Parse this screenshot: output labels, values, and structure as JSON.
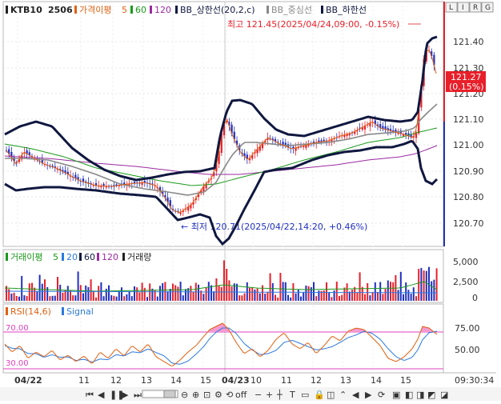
{
  "price_panel": {
    "legend": {
      "symbol": "KTB10",
      "code": "2506",
      "ma_label": "가격이평",
      "ma_5": "5",
      "ma_60": "60",
      "ma_120": "120",
      "bb_upper": "BB_상한선(20,2,c)",
      "bb_mid": "BB_중심선",
      "bb_lower": "BB_하한선"
    },
    "high_annotation": "최고 121.45(2025/04/24,09:00, -0.15%)",
    "low_annotation": "← 최저 120.71(2025/04/22,14:20, +0.46%)",
    "current_price": "121.27",
    "current_change": "(0.15%)",
    "y_ticks": [
      "121.40",
      "121.30",
      "121.20",
      "121.10",
      "121.00",
      "120.90",
      "120.80",
      "120.70"
    ]
  },
  "toolbar_icons": [
    "L",
    "I",
    "R",
    "G"
  ],
  "volume_panel": {
    "legend": {
      "ma_label": "거래이평",
      "ma_5": "5",
      "ma_20": "20",
      "ma_60": "60",
      "ma_120": "120",
      "volume": "거래량"
    },
    "y_ticks": [
      "5,000",
      "2,500",
      "0"
    ]
  },
  "rsi_panel": {
    "legend": {
      "rsi": "RSI(14,6)",
      "signal": "Signal"
    },
    "level_high": "70.00",
    "level_low": "30.00",
    "y_ticks": [
      "75.00",
      "50.00"
    ]
  },
  "x_axis": {
    "labels": [
      "04/22",
      "11",
      "12",
      "13",
      "14",
      "15",
      "04/23",
      "10",
      "11",
      "12",
      "13",
      "14",
      "15"
    ],
    "time": "09:30:34"
  },
  "colors": {
    "candle_up": "#e8202a",
    "candle_down": "#2030c0",
    "ma5": "#e06010",
    "ma20": "#2a7ae0",
    "ma60": "#1a9a1a",
    "ma120": "#9a2aa0",
    "bb_mid": "#888888",
    "bb_band": "#101840",
    "rsi": "#e06010",
    "signal": "#2a7ae0",
    "rsi_level": "#e040c0"
  },
  "nav_controls": [
    "first",
    "prev",
    "pause",
    "next",
    "last",
    "zoom-out",
    "zoom-in",
    "overlay",
    "settings",
    "reset",
    "off",
    "less-bars",
    "more-bars",
    "crosshair",
    "text",
    "screen",
    "lock",
    "gift",
    "chevron",
    "zoom-left",
    "zoom-right",
    "refresh"
  ]
}
